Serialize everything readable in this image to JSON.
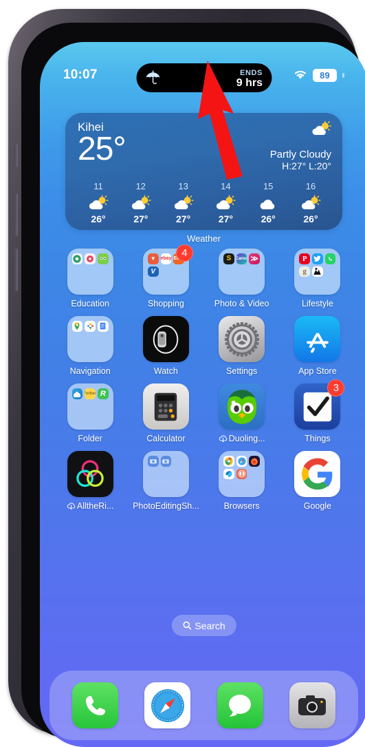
{
  "status_bar": {
    "time": "10:07",
    "wifi_icon": "wifi-icon",
    "battery_percent": "89"
  },
  "dynamic_island": {
    "left_icon": "umbrella-icon",
    "ends_label": "ENDS",
    "ends_value": "9 hrs"
  },
  "weather_widget": {
    "city": "Kihei",
    "temperature": "25°",
    "condition": "Partly Cloudy",
    "high_low": "H:27° L:20°",
    "condition_icon": "partly-cloudy-icon",
    "label": "Weather",
    "forecast": [
      {
        "day": "11",
        "icon": "partly-cloudy-icon",
        "temp": "26°"
      },
      {
        "day": "12",
        "icon": "partly-cloudy-icon",
        "temp": "27°"
      },
      {
        "day": "13",
        "icon": "partly-cloudy-icon",
        "temp": "27°"
      },
      {
        "day": "14",
        "icon": "partly-cloudy-icon",
        "temp": "27°"
      },
      {
        "day": "15",
        "icon": "cloudy-icon",
        "temp": "26°"
      },
      {
        "day": "16",
        "icon": "partly-cloudy-icon",
        "temp": "26°"
      }
    ]
  },
  "app_grid": {
    "rows": [
      [
        {
          "label": "Education",
          "type": "folder",
          "badge": null
        },
        {
          "label": "Shopping",
          "type": "folder",
          "badge": "4"
        },
        {
          "label": "Photo & Video",
          "type": "folder",
          "badge": null
        },
        {
          "label": "Lifestyle",
          "type": "folder",
          "badge": null
        }
      ],
      [
        {
          "label": "Navigation",
          "type": "folder",
          "badge": null
        },
        {
          "label": "Watch",
          "type": "app",
          "badge": null
        },
        {
          "label": "Settings",
          "type": "app",
          "badge": null
        },
        {
          "label": "App Store",
          "type": "app",
          "badge": null
        }
      ],
      [
        {
          "label": "Folder",
          "type": "folder",
          "badge": null
        },
        {
          "label": "Calculator",
          "type": "app",
          "badge": null
        },
        {
          "label": "Duoling...",
          "type": "app",
          "badge": null,
          "cloud": true
        },
        {
          "label": "Things",
          "type": "app",
          "badge": "3"
        }
      ],
      [
        {
          "label": "AlltheRi...",
          "type": "app",
          "badge": null,
          "cloud": true
        },
        {
          "label": "PhotoEditingSh...",
          "type": "folder",
          "badge": null
        },
        {
          "label": "Browsers",
          "type": "folder",
          "badge": null
        },
        {
          "label": "Google",
          "type": "app",
          "badge": null
        }
      ]
    ]
  },
  "search": {
    "label": "Search",
    "icon": "search-icon"
  },
  "dock": {
    "items": [
      {
        "name": "Phone",
        "icon": "phone-icon"
      },
      {
        "name": "Safari",
        "icon": "compass-icon"
      },
      {
        "name": "Messages",
        "icon": "message-bubble-icon"
      },
      {
        "name": "Camera",
        "icon": "camera-icon"
      }
    ]
  },
  "annotation": {
    "arrow_color": "#f41414",
    "arrow_target": "dynamic-island"
  }
}
